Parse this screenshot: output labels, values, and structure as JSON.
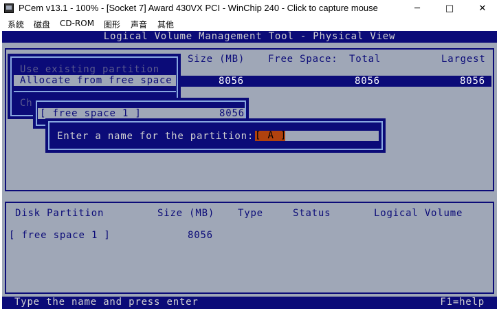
{
  "window": {
    "title": "PCem v13.1 - 100% - [Socket 7] Award 430VX PCI - WinChip 240 - Click to capture mouse",
    "minimize_glyph": "─",
    "maximize_glyph": "□",
    "close_glyph": "✕"
  },
  "menu": [
    "系統",
    "磁盘",
    "CD-ROM",
    "图形",
    "声音",
    "其他"
  ],
  "screen": {
    "header": "Logical Volume Management Tool - Physical View",
    "top_panel": {
      "columns": {
        "size": "Size (MB)",
        "free_space": "Free Space:",
        "total": "Total",
        "largest": "Largest"
      },
      "row": {
        "size": "8056",
        "total": "8056",
        "largest": "8056"
      }
    },
    "menu_dialog": {
      "option_disabled": "Use existing partition",
      "option_selected": "Allocate from free space",
      "option_partial": "Ch"
    },
    "free_space_dialog": {
      "item": "[ free space 1 ]",
      "size": "8056"
    },
    "name_dialog": {
      "prompt": "Enter a name for the partition:",
      "value": "[ A ]"
    },
    "bottom_panel": {
      "columns": {
        "disk_partition": "Disk Partition",
        "size": "Size (MB)",
        "type": "Type",
        "status": "Status",
        "logical_volume": "Logical Volume"
      },
      "row": {
        "name": "[ free space 1 ]",
        "size": "8056"
      }
    },
    "status_left": "Type the name and press enter",
    "status_right": "F1=help"
  },
  "colors": {
    "background": "#9fa7b7",
    "dark_blue": "#0b0b78",
    "dialog_border": "#88a8e0",
    "cursor": "#b0420e"
  }
}
